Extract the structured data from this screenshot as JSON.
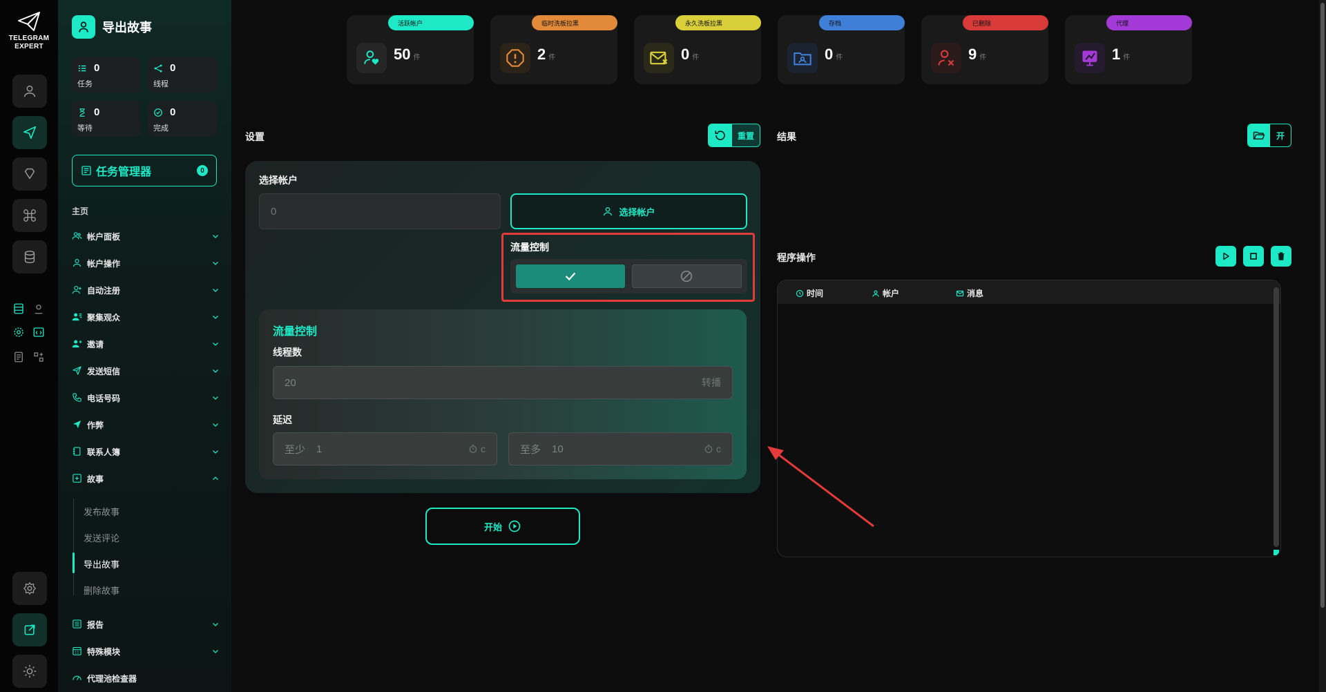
{
  "logo": {
    "line1": "TELEGRAM",
    "line2": "EXPERT"
  },
  "app": {
    "title": "导出故事"
  },
  "stats": [
    {
      "value": "0",
      "label": "任务",
      "icon": "tasks-icon"
    },
    {
      "value": "0",
      "label": "线程",
      "icon": "threads-icon"
    },
    {
      "value": "0",
      "label": "等待",
      "icon": "hourglass-icon"
    },
    {
      "value": "0",
      "label": "完成",
      "icon": "check-circle-icon"
    }
  ],
  "task_manager": {
    "label": "任务管理器",
    "count": "0"
  },
  "nav": {
    "home": "主页",
    "items": [
      {
        "label": "帐户面板"
      },
      {
        "label": "帐户操作"
      },
      {
        "label": "自动注册"
      },
      {
        "label": "聚集观众"
      },
      {
        "label": "邀请"
      },
      {
        "label": "发送短信"
      },
      {
        "label": "电话号码"
      },
      {
        "label": "作弊"
      },
      {
        "label": "联系人簿"
      },
      {
        "label": "故事"
      }
    ],
    "sub_items": [
      {
        "label": "发布故事"
      },
      {
        "label": "发送评论"
      },
      {
        "label": "导出故事"
      },
      {
        "label": "删除故事"
      }
    ],
    "bottom_items": [
      {
        "label": "报告"
      },
      {
        "label": "特殊模块"
      },
      {
        "label": "代理池检查器"
      }
    ]
  },
  "status_cards": [
    {
      "tag": "活跃帐户",
      "value": "50",
      "unit": "件",
      "color": "#1de9c6"
    },
    {
      "tag": "临时洗板拉黑",
      "value": "2",
      "unit": "件",
      "color": "#e38a3a"
    },
    {
      "tag": "永久洗板拉黑",
      "value": "0",
      "unit": "件",
      "color": "#d8cf3a"
    },
    {
      "tag": "存档",
      "value": "0",
      "unit": "件",
      "color": "#3f7fd8"
    },
    {
      "tag": "已删除",
      "value": "9",
      "unit": "件",
      "color": "#d83a3a"
    },
    {
      "tag": "代理",
      "value": "1",
      "unit": "件",
      "color": "#a33ad8"
    }
  ],
  "settings": {
    "title": "设置",
    "reset_label": "重置",
    "select_account_label": "选择帐户",
    "account_value": "0",
    "select_account_button": "选择帐户",
    "flow_control_label": "流量控制",
    "flow_section_title": "流量控制",
    "threads_label": "线程数",
    "threads_value": "20",
    "threads_suffix": "转播",
    "delay_label": "延迟",
    "delay_min_label": "至少",
    "delay_min_value": "1",
    "delay_max_label": "至多",
    "delay_max_value": "10",
    "delay_unit": "c",
    "start_label": "开始"
  },
  "results": {
    "title": "结果",
    "open_label": "开",
    "program_ops_title": "程序操作",
    "columns": [
      "时间",
      "帐户",
      "消息"
    ]
  },
  "colors": {
    "accent": "#1de9c6",
    "highlight": "#e33a3a"
  }
}
